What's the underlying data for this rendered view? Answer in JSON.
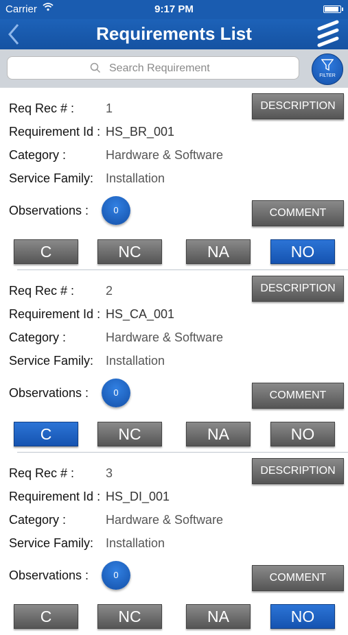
{
  "status_bar": {
    "carrier": "Carrier",
    "time": "9:17 PM"
  },
  "nav": {
    "title": "Requirements List"
  },
  "search": {
    "placeholder": "Search Requirement",
    "filter_label": "FILTER"
  },
  "labels": {
    "req_rec": "Req Rec # :",
    "requirement_id": "Requirement Id :",
    "category": "Category  :",
    "service_family": "Service Family:",
    "observations": "Observations :",
    "description_btn": "DESCRIPTION",
    "comment_btn": "COMMENT"
  },
  "options": [
    "C",
    "NC",
    "NA",
    "NO"
  ],
  "records": [
    {
      "rec_no": "1",
      "req_id": "HS_BR_001",
      "category": "Hardware & Software",
      "service_family": "Installation",
      "observations": "0",
      "selected": "NO"
    },
    {
      "rec_no": "2",
      "req_id": "HS_CA_001",
      "category": "Hardware & Software",
      "service_family": "Installation",
      "observations": "0",
      "selected": "C"
    },
    {
      "rec_no": "3",
      "req_id": "HS_DI_001",
      "category": "Hardware & Software",
      "service_family": "Installation",
      "observations": "0",
      "selected": "NO"
    }
  ],
  "colors": {
    "nav_blue": "#1a5cb0",
    "selected_blue": "#1553b0",
    "button_gray": "#6e6e6e"
  }
}
